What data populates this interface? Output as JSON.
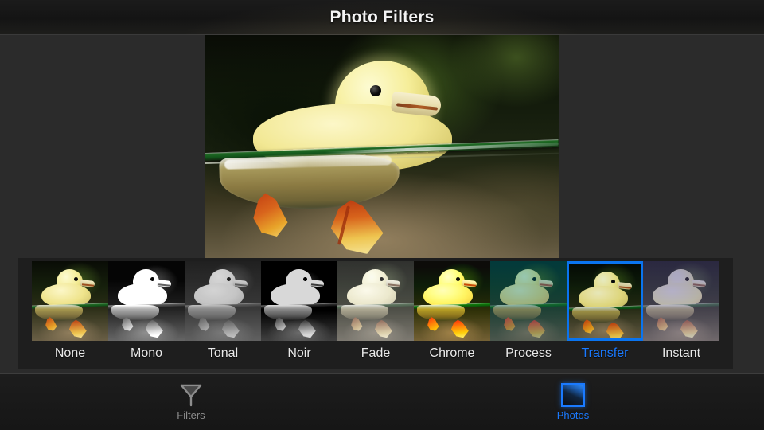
{
  "header": {
    "title": "Photo Filters"
  },
  "main_photo": {
    "name": "duckling-photo",
    "subject": "yellow duckling swimming",
    "applied_filter": "Transfer"
  },
  "filter_strip": {
    "selected": "Transfer",
    "accent_color": "#1a7aff",
    "items": [
      {
        "label": "None",
        "fx": "fx-none",
        "selected": false
      },
      {
        "label": "Mono",
        "fx": "fx-mono",
        "selected": false
      },
      {
        "label": "Tonal",
        "fx": "fx-tonal",
        "selected": false
      },
      {
        "label": "Noir",
        "fx": "fx-noir",
        "selected": false
      },
      {
        "label": "Fade",
        "fx": "fx-fade",
        "selected": false
      },
      {
        "label": "Chrome",
        "fx": "fx-chrome",
        "selected": false
      },
      {
        "label": "Process",
        "fx": "fx-process",
        "selected": false
      },
      {
        "label": "Transfer",
        "fx": "fx-transfer",
        "selected": true
      },
      {
        "label": "Instant",
        "fx": "fx-instant",
        "selected": false
      }
    ]
  },
  "tabbar": {
    "tabs": [
      {
        "label": "Filters",
        "icon": "funnel-icon",
        "selected": false,
        "color": "#8d8d8d"
      },
      {
        "label": "Photos",
        "icon": "photo-square-icon",
        "selected": true,
        "color": "#1a7aff"
      }
    ]
  }
}
